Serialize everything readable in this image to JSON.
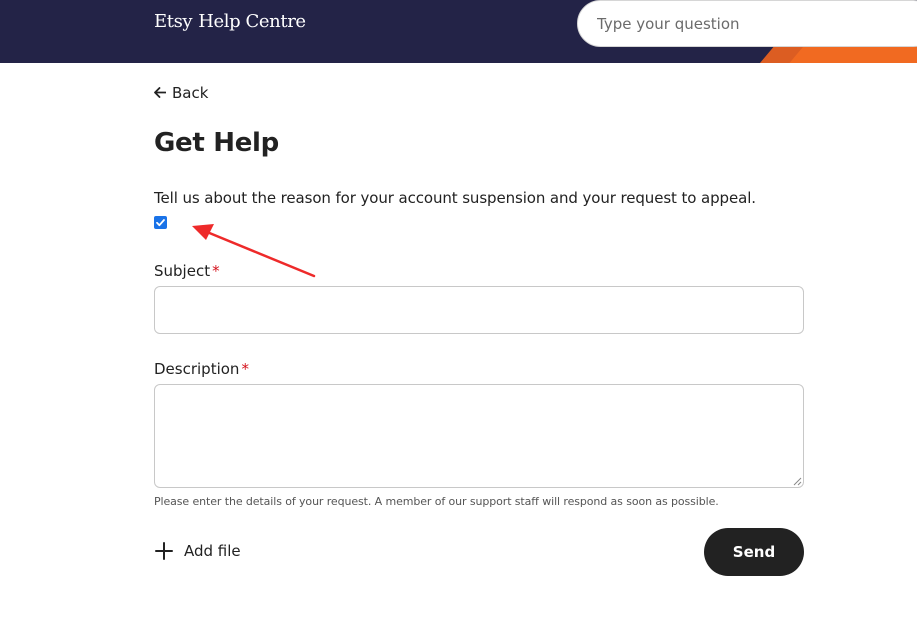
{
  "header": {
    "logo_brand": "Etsy",
    "logo_text": "Help Centre",
    "search_placeholder": "Type your question",
    "background_color": "#232347",
    "accent_color": "#f1641e"
  },
  "nav": {
    "back_label": "Back"
  },
  "page": {
    "title": "Get Help",
    "prompt": "Tell us about the reason for your account suspension and your request to appeal.",
    "checkbox_checked": true
  },
  "form": {
    "subject_label": "Subject",
    "subject_value": "",
    "description_label": "Description",
    "description_value": "",
    "required_marker": "*",
    "hint": "Please enter the details of your request. A member of our support staff will respond as soon as possible.",
    "add_file_label": "Add file",
    "send_label": "Send"
  },
  "icons": {
    "back": "arrow-left-icon",
    "add_file": "plus-icon",
    "checkbox": "check-icon"
  },
  "colors": {
    "annotation_arrow": "#ee2a2a",
    "checkbox": "#1a73e8",
    "required": "#d4121c",
    "send_button": "#222222"
  }
}
